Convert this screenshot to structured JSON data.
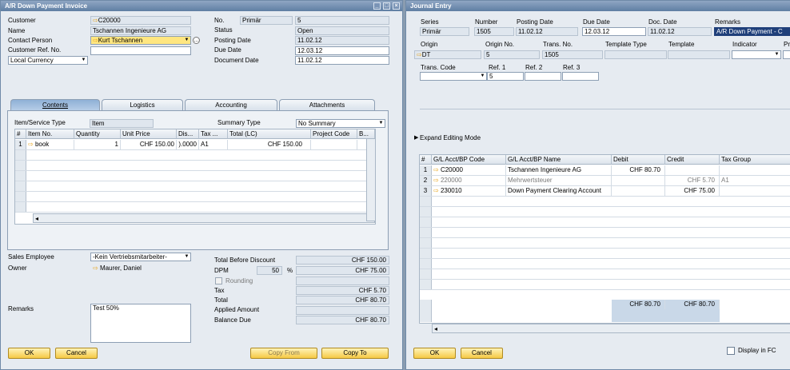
{
  "invoice": {
    "title": "A/R Down Payment Invoice",
    "customer_label": "Customer",
    "customer": "C20000",
    "name_label": "Name",
    "name": "Tschannen Ingenieure AG",
    "contact_label": "Contact Person",
    "contact": "Kurt Tschannen",
    "ref_label": "Customer Ref. No.",
    "ref": "",
    "currency": "Local Currency",
    "no_label": "No.",
    "series": "Primär",
    "no": "5",
    "status_label": "Status",
    "status": "Open",
    "posting_label": "Posting Date",
    "posting": "11.02.12",
    "due_label": "Due Date",
    "due": "12.03.12",
    "doc_label": "Document Date",
    "doc": "11.02.12",
    "tabs": [
      "Contents",
      "Logistics",
      "Accounting",
      "Attachments"
    ],
    "item_type_label": "Item/Service Type",
    "item_type": "Item",
    "summary_label": "Summary Type",
    "summary": "No Summary",
    "cols": [
      "#",
      "Item No.",
      "Quantity",
      "Unit Price",
      "Dis...",
      "Tax ...",
      "Total (LC)",
      "Project Code",
      "B..."
    ],
    "row": {
      "n": "1",
      "item": "book",
      "qty": "1",
      "price": "CHF 150.00",
      ".disc": "",
      "disc": ").0000",
      "tax": "A1",
      "total": "CHF 150.00"
    },
    "sales_label": "Sales Employee",
    "sales": "-Kein Vertriebsmitarbeiter-",
    "owner_label": "Owner",
    "owner": "Maurer, Daniel",
    "remarks_label": "Remarks",
    "remarks": "Test 50%",
    "tbd_label": "Total Before Discount",
    "tbd": "CHF 150.00",
    "dpm_label": "DPM",
    "dpm_pct": "50",
    "pct": "%",
    "dpm": "CHF 75.00",
    "rounding_label": "Rounding",
    "tax_label": "Tax",
    "tax": "CHF 5.70",
    "total_label": "Total",
    "total": "CHF 80.70",
    "applied_label": "Applied Amount",
    "applied": "",
    "balance_label": "Balance Due",
    "balance": "CHF 80.70",
    "ok": "OK",
    "cancel": "Cancel",
    "copy_from": "Copy From",
    "copy_to": "Copy To"
  },
  "journal": {
    "title": "Journal Entry",
    "series_label": "Series",
    "series": "Primär",
    "number_label": "Number",
    "number": "1505",
    "posting_label": "Posting Date",
    "posting": "11.02.12",
    "due_label": "Due Date",
    "due": "12.03.12",
    "doc_label": "Doc. Date",
    "doc": "11.02.12",
    "remarks_label": "Remarks",
    "remarks": "A/R Down Payment - C",
    "origin_label": "Origin",
    "origin": "DT",
    "origin_no_label": "Origin No.",
    "origin_no": "5",
    "trans_no_label": "Trans. No.",
    "trans_no": "1505",
    "template_type_label": "Template Type",
    "template_label": "Template",
    "indicator_label": "Indicator",
    "pr_label": "Pro",
    "trans_code_label": "Trans. Code",
    "ref1_label": "Ref. 1",
    "ref1": "5",
    "ref2_label": "Ref. 2",
    "ref3_label": "Ref. 3",
    "expand": "Expand Editing Mode",
    "cols": [
      "#",
      "G/L Acct/BP Code",
      "G/L Acct/BP Name",
      "Debit",
      "Credit",
      "Tax Group"
    ],
    "rows": [
      {
        "n": "1",
        "code": "C20000",
        "name": "Tschannen Ingenieure AG",
        "debit": "CHF 80.70",
        "credit": "",
        "tax": ""
      },
      {
        "n": "2",
        "code": "220000",
        "name": "Mehrwertsteuer",
        "debit": "",
        "credit": "CHF 5.70",
        "tax": "A1"
      },
      {
        "n": "3",
        "code": "230010",
        "name": "Down Payment Clearing Account",
        "debit": "",
        "credit": "CHF 75.00",
        "tax": ""
      }
    ],
    "debit_total": "CHF 80.70",
    "credit_total": "CHF 80.70",
    "ok": "OK",
    "cancel": "Cancel",
    "display_fc": "Display in FC"
  }
}
